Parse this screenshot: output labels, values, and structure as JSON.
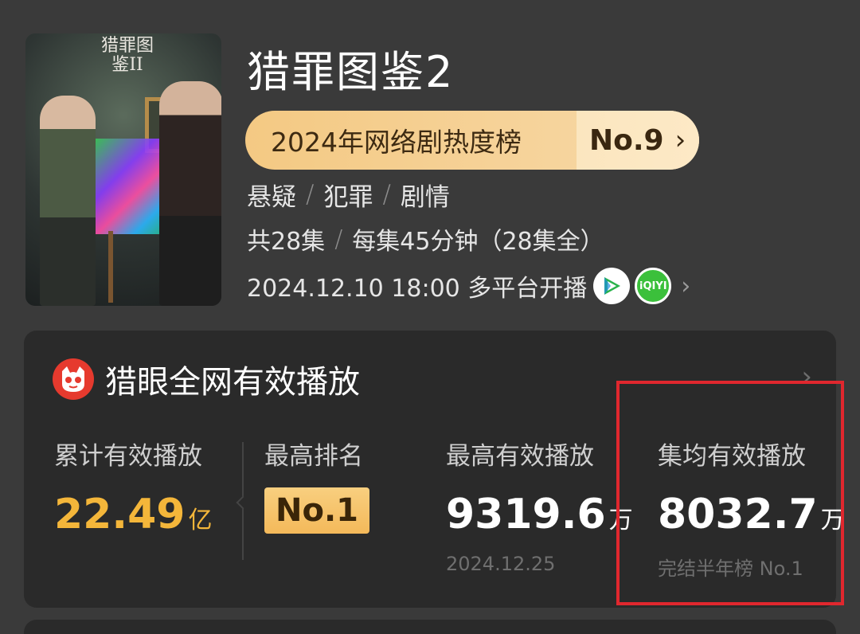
{
  "poster": {
    "title_text": "猎罪图鉴II",
    "icon": "drama-poster-image"
  },
  "show": {
    "title": "猎罪图鉴2",
    "ranking": {
      "label": "2024年网络剧热度榜",
      "position": "No.9",
      "chevron": "›"
    },
    "genres": [
      "悬疑",
      "犯罪",
      "剧情"
    ],
    "genre_separator": "/",
    "episodes": {
      "count": "共28集",
      "length": "每集45分钟（28集全）"
    },
    "premiere": {
      "text": "2024.12.10 18:00 多平台开播",
      "platforms": [
        "tencent-video-icon",
        "iqiyi-icon"
      ],
      "iqiyi_label": "iQIYI",
      "chevron": "›"
    }
  },
  "stats_card": {
    "title": "猎眼全网有效播放",
    "chevron": "›",
    "logo_icon": "maoyan-cat-icon",
    "metrics": {
      "total": {
        "label": "累计有效播放",
        "value": "22.49",
        "unit": "亿"
      },
      "top_rank": {
        "label": "最高排名",
        "value": "No.1"
      },
      "peak": {
        "label": "最高有效播放",
        "value": "9319.6",
        "unit": "万",
        "date": "2024.12.25"
      },
      "average": {
        "label": "集均有效播放",
        "value": "8032.7",
        "unit": "万",
        "note": "完结半年榜 No.1"
      }
    }
  },
  "colors": {
    "background": "#3a3a3a",
    "card": "#2a2a2a",
    "accent_gold": "#f4b63a",
    "highlight_red": "#e0272e",
    "maoyan_red": "#e63a2e"
  }
}
